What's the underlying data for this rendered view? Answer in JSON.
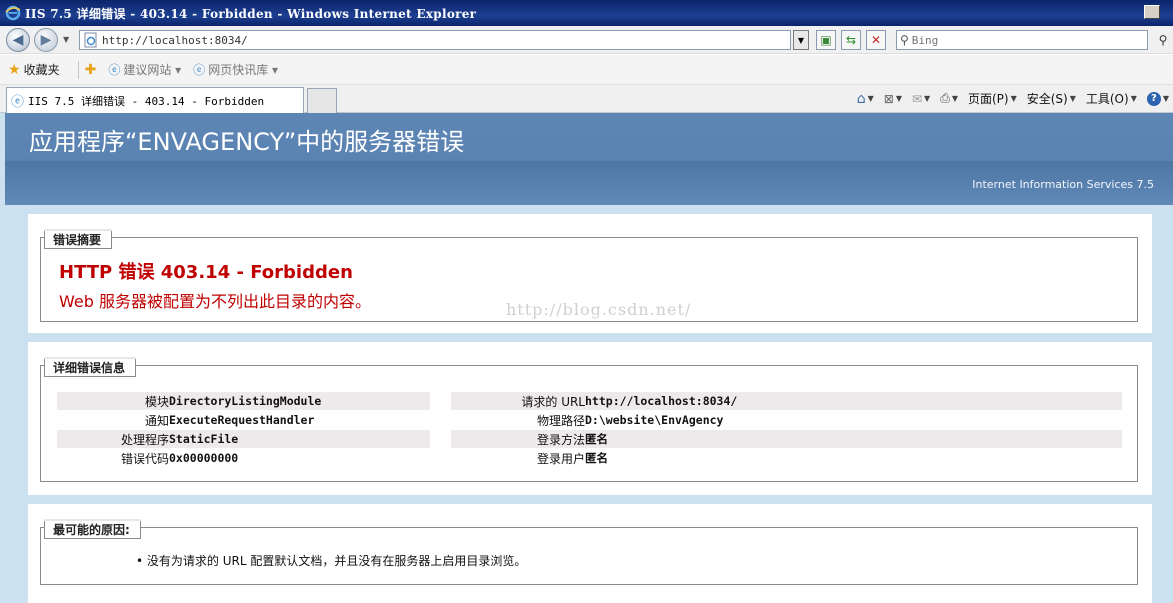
{
  "window": {
    "title": "IIS 7.5 详细错误 - 403.14 - Forbidden - Windows Internet Explorer"
  },
  "address_bar": {
    "url": "http://localhost:8034/",
    "search_placeholder": "Bing"
  },
  "favorites_bar": {
    "favorites_label": "收藏夹",
    "items": [
      {
        "label": "建议网站 ▾"
      },
      {
        "label": "网页快讯库 ▾"
      }
    ]
  },
  "tabs": [
    {
      "label": "IIS 7.5 详细错误 - 403.14 - Forbidden"
    }
  ],
  "command_bar": {
    "page": "页面(P)",
    "safety": "安全(S)",
    "tools": "工具(O)"
  },
  "page": {
    "header_title": "应用程序“ENVAGENCY”中的服务器错误",
    "server_name": "Internet Information Services 7.5",
    "watermark": "http://blog.csdn.net/",
    "summary": {
      "legend": "错误摘要",
      "title": "HTTP 错误 403.14 - Forbidden",
      "description": "Web 服务器被配置为不列出此目录的内容。"
    },
    "details": {
      "legend": "详细错误信息",
      "left": [
        {
          "label": "模块",
          "value": "DirectoryListingModule"
        },
        {
          "label": "通知",
          "value": "ExecuteRequestHandler"
        },
        {
          "label": "处理程序",
          "value": "StaticFile"
        },
        {
          "label": "错误代码",
          "value": "0x00000000"
        }
      ],
      "right": [
        {
          "label": "请求的 URL",
          "value": "http://localhost:8034/"
        },
        {
          "label": "物理路径",
          "value": "D:\\website\\EnvAgency"
        },
        {
          "label": "登录方法",
          "value": "匿名"
        },
        {
          "label": "登录用户",
          "value": "匿名"
        }
      ]
    },
    "causes": {
      "legend": "最可能的原因:",
      "items": [
        "没有为请求的 URL 配置默认文档，并且没有在服务器上启用目录浏览。"
      ]
    }
  }
}
